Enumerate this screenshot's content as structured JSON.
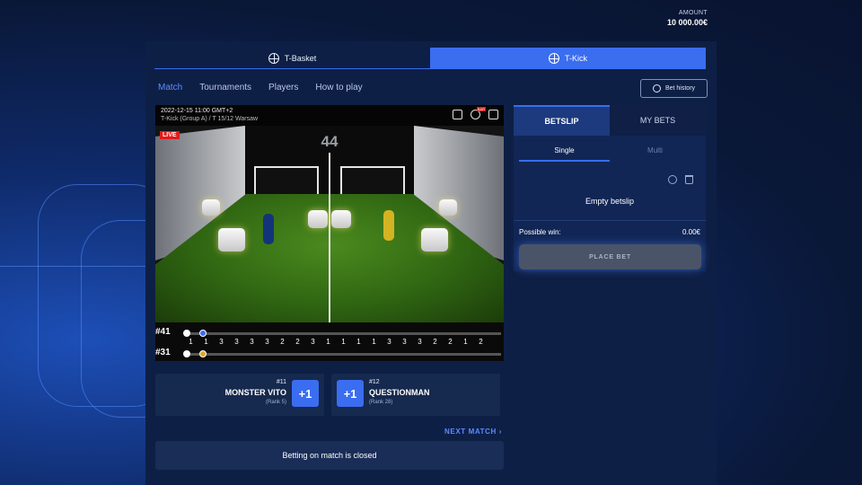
{
  "header": {
    "amount_label": "AMOUNT",
    "amount_value": "10 000.00€"
  },
  "game_tabs": [
    {
      "label": "T-Basket",
      "active": false
    },
    {
      "label": "T-Kick",
      "active": true
    }
  ],
  "subnav": [
    "Match",
    "Tournaments",
    "Players",
    "How to play"
  ],
  "bet_history_label": "Bet history",
  "video": {
    "datetime": "2022-12-15 11:00 GMT+2",
    "league": "T-Kick    (Group A) / T 15/12 Warsaw",
    "live": "LIVE",
    "score": "44",
    "badge": "BAR"
  },
  "timeline": {
    "top_label": "#41",
    "bottom_label": "#31",
    "numbers": [
      "1",
      "1",
      "3",
      "3",
      "3",
      "3",
      "2",
      "2",
      "3",
      "1",
      "1",
      "1",
      "1",
      "3",
      "3",
      "3",
      "2",
      "2",
      "1",
      "2"
    ]
  },
  "teams": [
    {
      "number": "#11",
      "name": "MONSTER VITO",
      "rank": "(Rank 5)",
      "button": "+1"
    },
    {
      "number": "#12",
      "name": "QUESTIONMAN",
      "rank": "(Rank 28)",
      "button": "+1"
    }
  ],
  "next_match": "NEXT MATCH",
  "betting_closed": "Betting on match is closed",
  "betslip": {
    "tabs": [
      "BETSLIP",
      "MY BETS"
    ],
    "subtabs": [
      "Single",
      "Multi"
    ],
    "empty": "Empty betslip",
    "possible_win_label": "Possible win:",
    "possible_win_value": "0.00€",
    "place_bet": "PLACE BET"
  },
  "colors": {
    "accent": "#3a6df0",
    "live": "#e01b1b",
    "panel": "#0e1f46"
  }
}
